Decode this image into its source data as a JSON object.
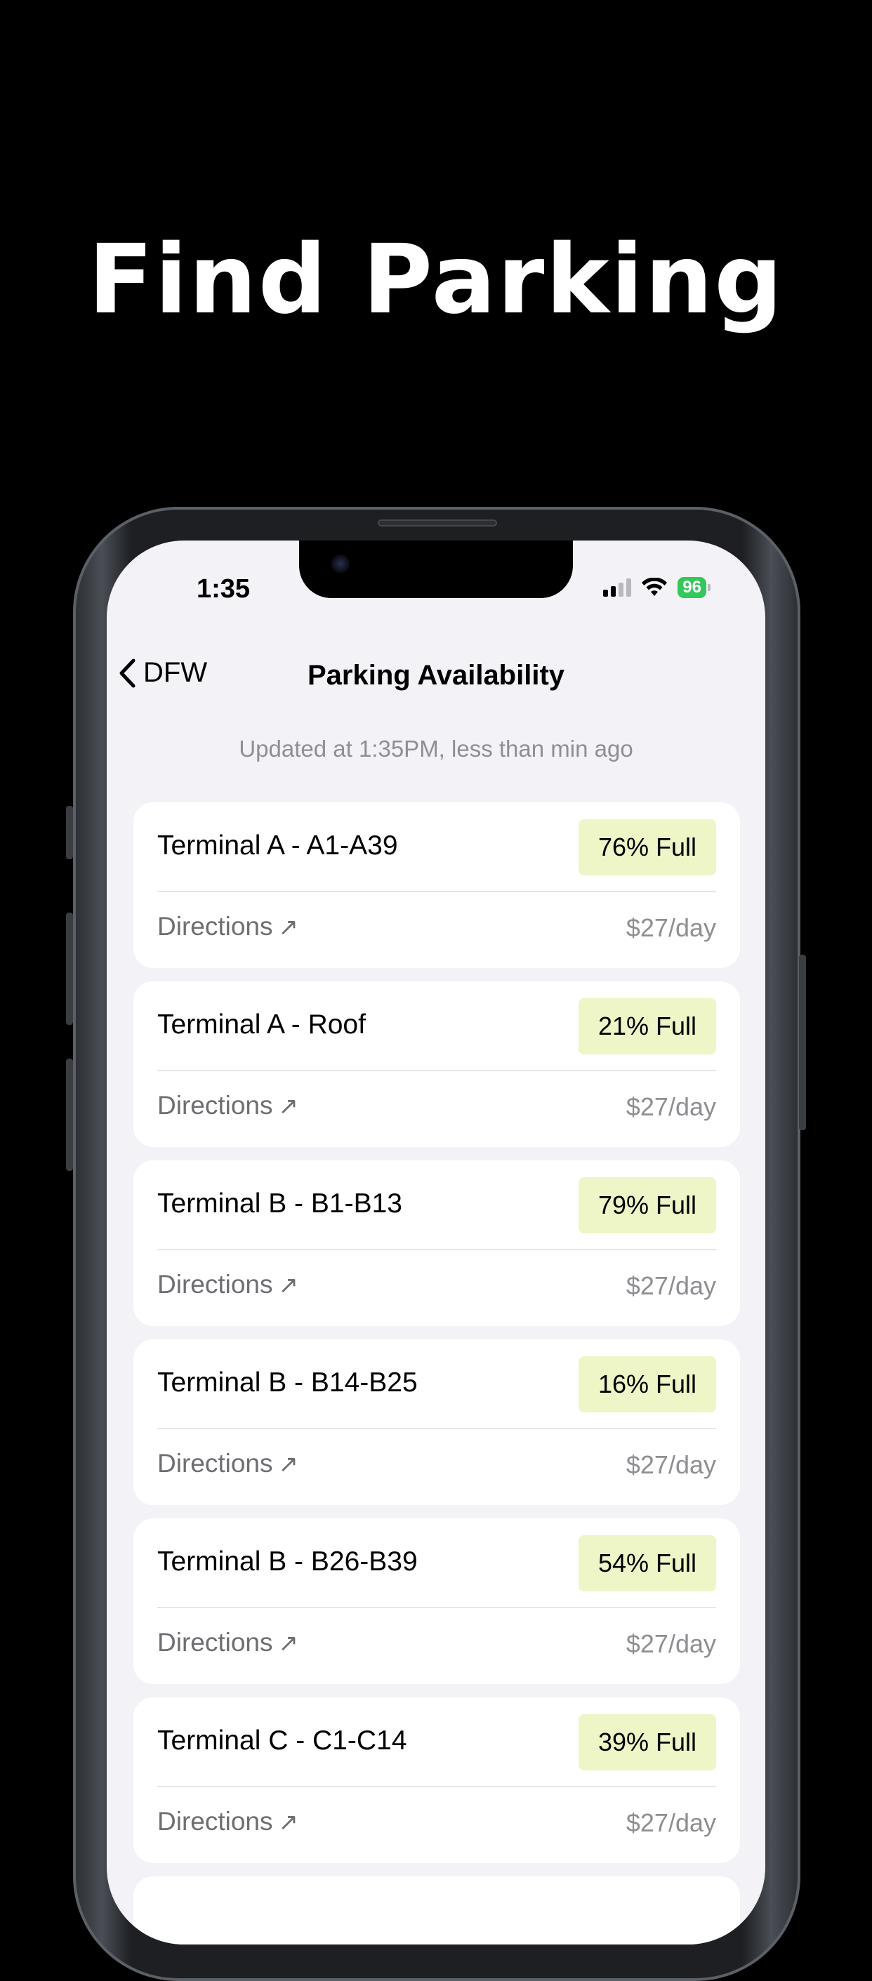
{
  "headline": "Find Parking",
  "status_bar": {
    "time": "1:35",
    "battery": "96"
  },
  "nav": {
    "back_label": "DFW",
    "title": "Parking Availability"
  },
  "updated_text": "Updated at 1:35PM, less than min ago",
  "lots": [
    {
      "name": "Terminal A - A1-A39",
      "badge": "76% Full",
      "directions": "Directions",
      "price": "$27/day"
    },
    {
      "name": "Terminal A - Roof",
      "badge": "21% Full",
      "directions": "Directions",
      "price": "$27/day"
    },
    {
      "name": "Terminal B - B1-B13",
      "badge": "79% Full",
      "directions": "Directions",
      "price": "$27/day"
    },
    {
      "name": "Terminal B - B14-B25",
      "badge": "16% Full",
      "directions": "Directions",
      "price": "$27/day"
    },
    {
      "name": "Terminal B - B26-B39",
      "badge": "54% Full",
      "directions": "Directions",
      "price": "$27/day"
    },
    {
      "name": "Terminal C - C1-C14",
      "badge": "39% Full",
      "directions": "Directions",
      "price": "$27/day"
    }
  ],
  "colors": {
    "background": "#000000",
    "screen": "#f2f2f7",
    "badge": "#eef5c6",
    "battery": "#34c759"
  },
  "icons": {
    "back": "chevron-left-icon",
    "directions": "arrow-up-right-icon",
    "signal": "cellular-signal-icon",
    "wifi": "wifi-icon",
    "battery": "battery-icon"
  }
}
